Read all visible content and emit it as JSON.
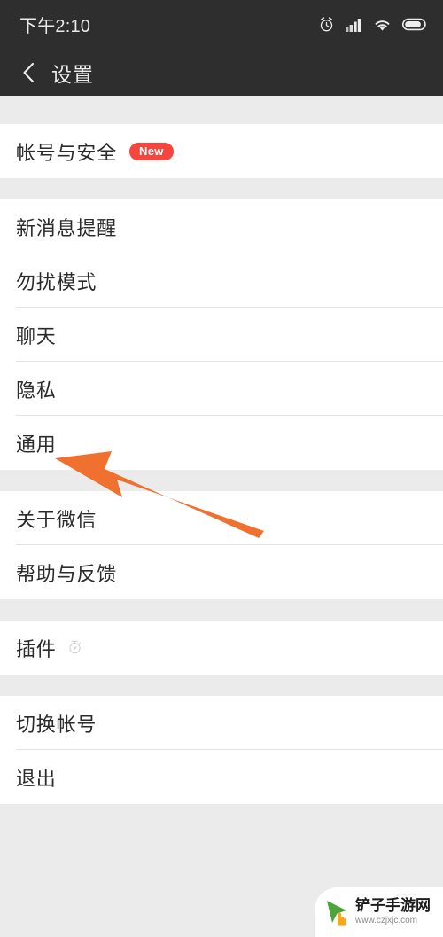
{
  "statusbar": {
    "time": "下午2:10",
    "icons": [
      "alarm-clock-icon",
      "signal-bars-icon",
      "wifi-icon",
      "battery-icon"
    ]
  },
  "header": {
    "back_icon": "chevron-left-icon",
    "title": "设置"
  },
  "sections": [
    {
      "rows": [
        {
          "label": "帐号与安全",
          "badge": "New"
        }
      ]
    },
    {
      "rows": [
        {
          "label": "新消息提醒"
        },
        {
          "label": "勿扰模式"
        },
        {
          "label": "聊天"
        },
        {
          "label": "隐私"
        },
        {
          "label": "通用"
        }
      ]
    },
    {
      "rows": [
        {
          "label": "关于微信"
        },
        {
          "label": "帮助与反馈"
        }
      ]
    },
    {
      "rows": [
        {
          "label": "插件",
          "icon": "compass-circle-icon"
        }
      ]
    },
    {
      "rows": [
        {
          "label": "切换帐号"
        },
        {
          "label": "退出"
        }
      ]
    }
  ],
  "annotation": {
    "type": "arrow",
    "color": "#f07030",
    "points_to": "通用"
  },
  "watermark": {
    "name": "铲子手游网",
    "url": "www.czjxjc.com",
    "logo": "green-cursor-play-icon",
    "logo_color": "#4ca53a"
  },
  "colors": {
    "statusbar_bg": "#2e2e2e",
    "header_bg": "#2e2e2e",
    "page_bg": "#ebebeb",
    "card_bg": "#ffffff",
    "text": "#2b2b2b",
    "badge_red": "#f4453e",
    "arrow_orange": "#f07030"
  }
}
